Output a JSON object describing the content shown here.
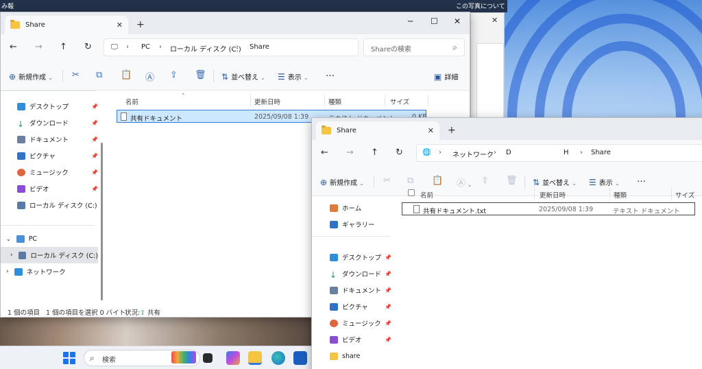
{
  "desktop": {
    "top_left_label": "み報",
    "top_right_label": "この写真についての",
    "taskbar": {
      "search_placeholder": "検索"
    }
  },
  "win1": {
    "tab_title": "Share",
    "breadcrumb": [
      "PC",
      "ローカル ディスク (C:)",
      "Share"
    ],
    "search_placeholder": "Shareの検索",
    "toolbar": {
      "new": "新規作成",
      "sort": "並べ替え",
      "view": "表示",
      "more": "…",
      "details": "詳細"
    },
    "columns": {
      "name": "名前",
      "modified": "更新日時",
      "type": "種類",
      "size": "サイズ"
    },
    "files": [
      {
        "name": "共有ドキュメント",
        "modified": "2025/09/08 1:39",
        "type": "テキスト ドキュメント",
        "size": "0 KB"
      }
    ],
    "sidebar": [
      {
        "label": "デスクトップ",
        "pinned": true
      },
      {
        "label": "ダウンロード",
        "pinned": true
      },
      {
        "label": "ドキュメント",
        "pinned": true
      },
      {
        "label": "ピクチャ",
        "pinned": true
      },
      {
        "label": "ミュージック",
        "pinned": true
      },
      {
        "label": "ビデオ",
        "pinned": true
      },
      {
        "label": "ローカル ディスク (C:)",
        "pinned": false
      }
    ],
    "tree": {
      "pc": "PC",
      "local_disk": "ローカル ディスク (C:)",
      "network": "ネットワーク"
    },
    "status": {
      "count": "1 個の項目",
      "selected": "1 個の項目を選択 0 バイト",
      "state_label": "状況:",
      "state_value": "共有"
    }
  },
  "win2": {
    "tab_title": "Share",
    "breadcrumb": [
      "ネットワーク",
      "D",
      "H",
      "Share"
    ],
    "toolbar": {
      "new": "新規作成",
      "sort": "並べ替え",
      "view": "表示",
      "more": "…"
    },
    "columns": {
      "name": "名前",
      "modified": "更新日時",
      "type": "種類",
      "size": "サイズ"
    },
    "files": [
      {
        "name": "共有ドキュメント.txt",
        "modified": "2025/09/08 1:39",
        "type": "テキスト ドキュメント"
      }
    ],
    "sidebar_top": [
      {
        "label": "ホーム"
      },
      {
        "label": "ギャラリー"
      }
    ],
    "sidebar": [
      {
        "label": "デスクトップ",
        "pinned": true
      },
      {
        "label": "ダウンロード",
        "pinned": true
      },
      {
        "label": "ドキュメント",
        "pinned": true
      },
      {
        "label": "ピクチャ",
        "pinned": true
      },
      {
        "label": "ミュージック",
        "pinned": true
      },
      {
        "label": "ビデオ",
        "pinned": true
      },
      {
        "label": "share",
        "pinned": false
      }
    ]
  }
}
